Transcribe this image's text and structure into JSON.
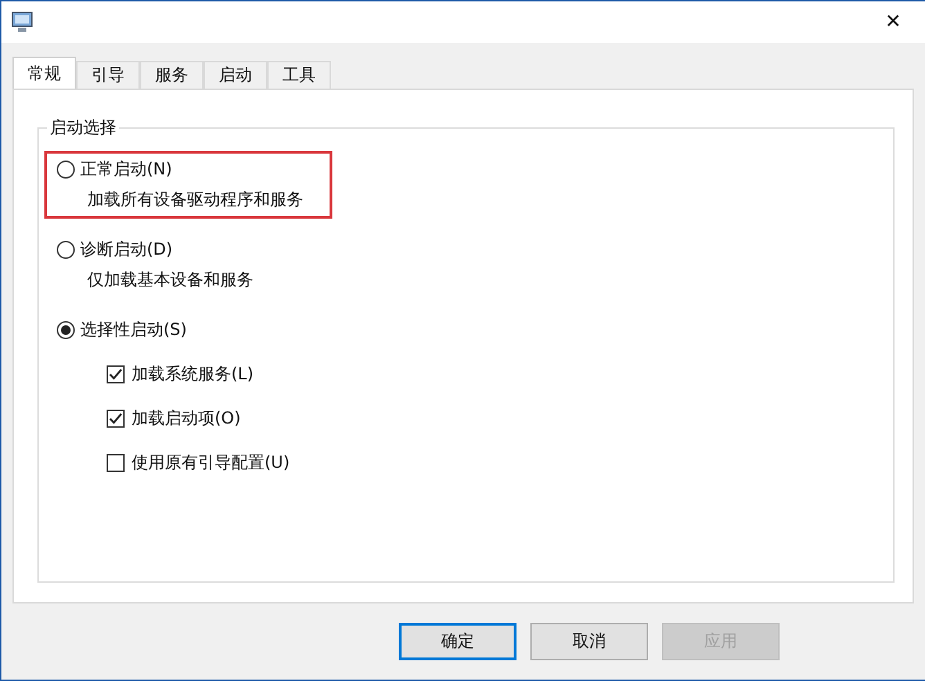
{
  "window": {
    "close_symbol": "✕"
  },
  "tabs": [
    {
      "label": "常规",
      "selected": true
    },
    {
      "label": "引导",
      "selected": false
    },
    {
      "label": "服务",
      "selected": false
    },
    {
      "label": "启动",
      "selected": false
    },
    {
      "label": "工具",
      "selected": false
    }
  ],
  "group": {
    "title": "启动选择",
    "options": [
      {
        "label": "正常启动(N)",
        "selected": false,
        "highlighted": true,
        "description": "加载所有设备驱动程序和服务"
      },
      {
        "label": "诊断启动(D)",
        "selected": false,
        "highlighted": false,
        "description": "仅加载基本设备和服务"
      },
      {
        "label": "选择性启动(S)",
        "selected": true,
        "highlighted": false,
        "checkboxes": [
          {
            "label": "加载系统服务(L)",
            "checked": true
          },
          {
            "label": "加载启动项(O)",
            "checked": true
          },
          {
            "label": "使用原有引导配置(U)",
            "checked": false
          }
        ]
      }
    ]
  },
  "buttons": [
    {
      "label": "确定",
      "default": true,
      "disabled": false
    },
    {
      "label": "取消",
      "default": false,
      "disabled": false
    },
    {
      "label": "应用",
      "default": false,
      "disabled": true
    }
  ]
}
